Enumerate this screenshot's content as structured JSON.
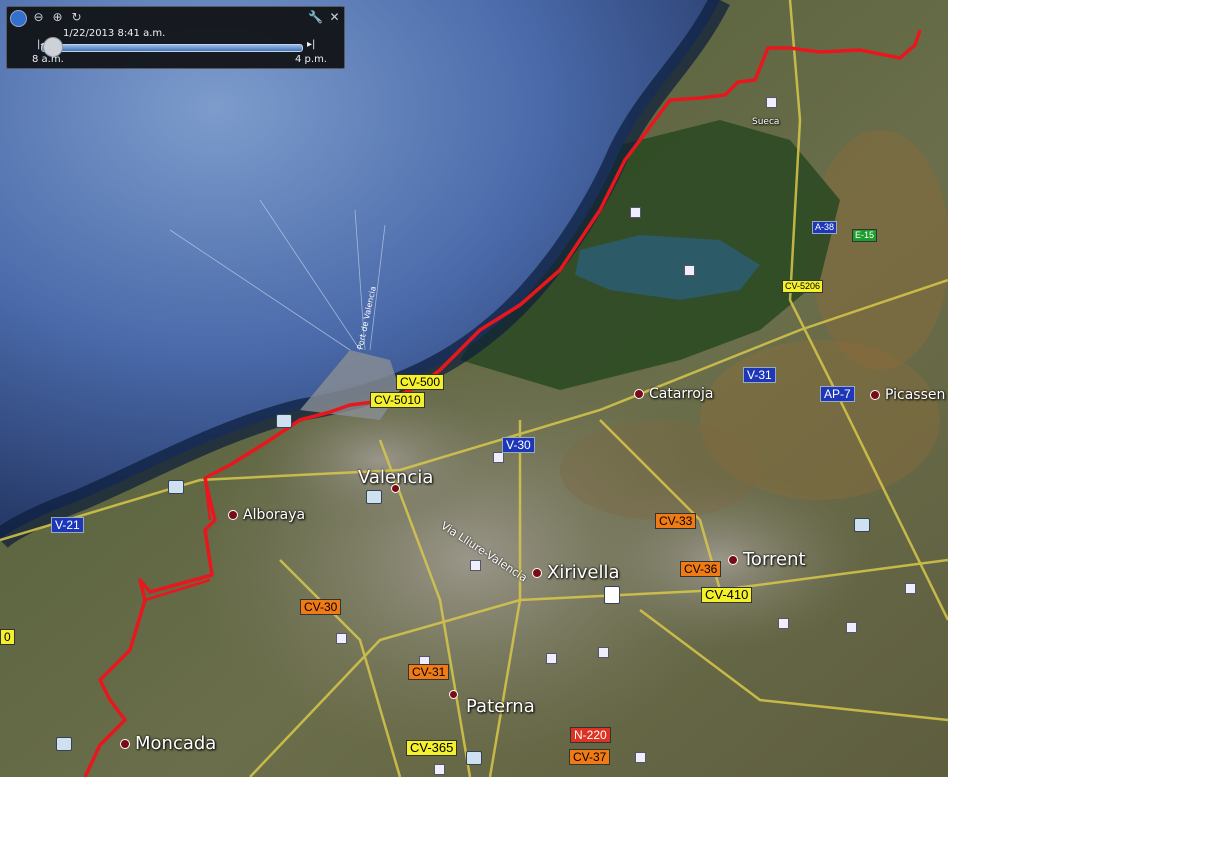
{
  "time_slider": {
    "date_time": "1/22/2013   8:41 a.m.",
    "start_label": "8 a.m.",
    "end_label": "4 p.m.",
    "icons": [
      "clock-icon",
      "zoom-out-icon",
      "zoom-in-icon",
      "refresh-icon",
      "wrench-icon",
      "close-icon"
    ]
  },
  "places": {
    "valencia": "Valencia",
    "alboraya": "Alboraya",
    "xirivella": "Xirivella",
    "torrent": "Torrent",
    "paterna": "Paterna",
    "moncada": "Moncada",
    "catarroja": "Catarroja",
    "picassent": "Picassen",
    "sueca": "Sueca"
  },
  "road_shields": {
    "cv500": "CV-500",
    "cv5010": "CV-5010",
    "v30": "V-30",
    "v21": "V-21",
    "v31": "V-31",
    "ap7": "AP-7",
    "a38": "A-38",
    "e15": "E-15",
    "cv5206": "CV-5206",
    "cv33": "CV-33",
    "cv36": "CV-36",
    "cv410": "CV-410",
    "cv30": "CV-30",
    "cv31": "CV-31",
    "cv365": "CV-365",
    "n220": "N-220",
    "cv37": "CV-37",
    "edge_partial": "0"
  },
  "streets": {
    "via_valencia": "Via Lliure-Valencia",
    "port_label": "Port de Valencia"
  },
  "colors": {
    "route": "#e8171d",
    "sea": "#3a5a9a",
    "land": "#556236",
    "lagoon": "#2e5a63"
  }
}
